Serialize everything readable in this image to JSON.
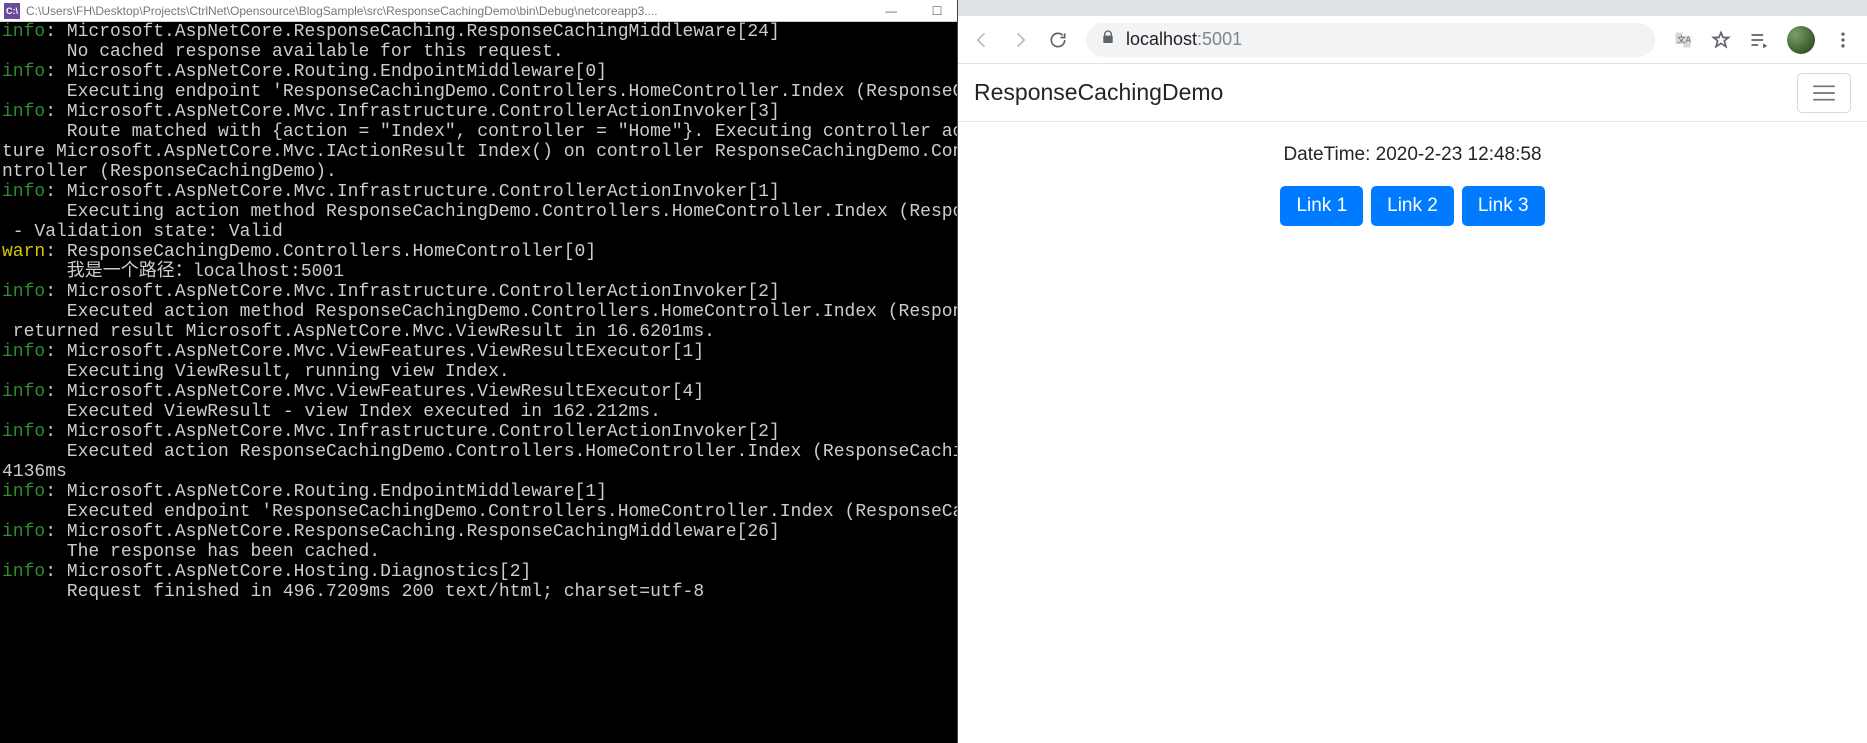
{
  "console": {
    "icon_text": "C:\\",
    "title": "C:\\Users\\FH\\Desktop\\Projects\\CtrlNet\\Opensource\\BlogSample\\src\\ResponseCachingDemo\\bin\\Debug\\netcoreapp3....",
    "lines": [
      {
        "level": "info",
        "head": "info",
        "colon": ": ",
        "body": "Microsoft.AspNetCore.ResponseCaching.ResponseCachingMiddleware[24]"
      },
      {
        "level": "cont",
        "body": "      No cached response available for this request."
      },
      {
        "level": "info",
        "head": "info",
        "colon": ": ",
        "body": "Microsoft.AspNetCore.Routing.EndpointMiddleware[0]"
      },
      {
        "level": "cont",
        "body": "      Executing endpoint 'ResponseCachingDemo.Controllers.HomeController.Index (ResponseCaching"
      },
      {
        "level": "info",
        "head": "info",
        "colon": ": ",
        "body": "Microsoft.AspNetCore.Mvc.Infrastructure.ControllerActionInvoker[3]"
      },
      {
        "level": "cont",
        "body": "      Route matched with {action = \"Index\", controller = \"Home\"}. Executing controller action w"
      },
      {
        "level": "cont",
        "body": "ture Microsoft.AspNetCore.Mvc.IActionResult Index() on controller ResponseCachingDemo.Controlle"
      },
      {
        "level": "cont",
        "body": "ntroller (ResponseCachingDemo)."
      },
      {
        "level": "info",
        "head": "info",
        "colon": ": ",
        "body": "Microsoft.AspNetCore.Mvc.Infrastructure.ControllerActionInvoker[1]"
      },
      {
        "level": "cont",
        "body": "      Executing action method ResponseCachingDemo.Controllers.HomeController.Index (ResponseCac"
      },
      {
        "level": "cont",
        "body": " - Validation state: Valid"
      },
      {
        "level": "warn",
        "head": "warn",
        "colon": ": ",
        "body": "ResponseCachingDemo.Controllers.HomeController[0]"
      },
      {
        "level": "cont",
        "body": "      我是一个路径：localhost:5001"
      },
      {
        "level": "info",
        "head": "info",
        "colon": ": ",
        "body": "Microsoft.AspNetCore.Mvc.Infrastructure.ControllerActionInvoker[2]"
      },
      {
        "level": "cont",
        "body": "      Executed action method ResponseCachingDemo.Controllers.HomeController.Index (ResponseCach"
      },
      {
        "level": "cont",
        "body": " returned result Microsoft.AspNetCore.Mvc.ViewResult in 16.6201ms."
      },
      {
        "level": "info",
        "head": "info",
        "colon": ": ",
        "body": "Microsoft.AspNetCore.Mvc.ViewFeatures.ViewResultExecutor[1]"
      },
      {
        "level": "cont",
        "body": "      Executing ViewResult, running view Index."
      },
      {
        "level": "info",
        "head": "info",
        "colon": ": ",
        "body": "Microsoft.AspNetCore.Mvc.ViewFeatures.ViewResultExecutor[4]"
      },
      {
        "level": "cont",
        "body": "      Executed ViewResult - view Index executed in 162.212ms."
      },
      {
        "level": "info",
        "head": "info",
        "colon": ": ",
        "body": "Microsoft.AspNetCore.Mvc.Infrastructure.ControllerActionInvoker[2]"
      },
      {
        "level": "cont",
        "body": "      Executed action ResponseCachingDemo.Controllers.HomeController.Index (ResponseCachingDemo"
      },
      {
        "level": "cont",
        "body": "4136ms"
      },
      {
        "level": "info",
        "head": "info",
        "colon": ": ",
        "body": "Microsoft.AspNetCore.Routing.EndpointMiddleware[1]"
      },
      {
        "level": "cont",
        "body": "      Executed endpoint 'ResponseCachingDemo.Controllers.HomeController.Index (ResponseCachingD"
      },
      {
        "level": "info",
        "head": "info",
        "colon": ": ",
        "body": "Microsoft.AspNetCore.ResponseCaching.ResponseCachingMiddleware[26]"
      },
      {
        "level": "cont",
        "body": "      The response has been cached."
      },
      {
        "level": "info",
        "head": "info",
        "colon": ": ",
        "body": "Microsoft.AspNetCore.Hosting.Diagnostics[2]"
      },
      {
        "level": "cont",
        "body": "      Request finished in 496.7209ms 200 text/html; charset=utf-8"
      }
    ]
  },
  "browser": {
    "address_host": "localhost",
    "address_port": ":5001",
    "page": {
      "brand": "ResponseCachingDemo",
      "datetime_label": "DateTime: 2020-2-23 12:48:58",
      "links": [
        "Link 1",
        "Link 2",
        "Link 3"
      ]
    }
  }
}
